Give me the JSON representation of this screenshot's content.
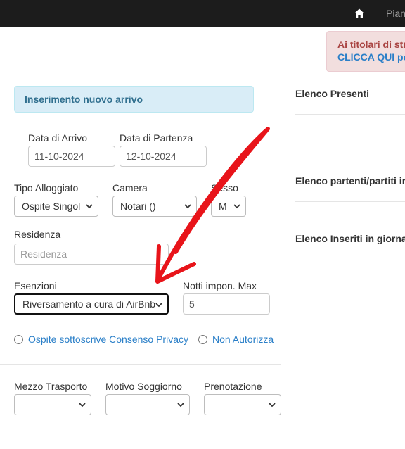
{
  "topbar": {
    "nav_label": "Pian"
  },
  "alert_danger": {
    "line1": "Ai titolari di str",
    "line2": "CLICCA QUI pe"
  },
  "form": {
    "heading": "Inserimento nuovo arrivo",
    "arrival": {
      "label": "Data di Arrivo",
      "value": "11-10-2024"
    },
    "departure": {
      "label": "Data di Partenza",
      "value": "12-10-2024"
    },
    "tipo_alloggiato": {
      "label": "Tipo Alloggiato",
      "value": "Ospite Singol"
    },
    "camera": {
      "label": "Camera",
      "value": "Notari ()"
    },
    "sesso": {
      "label": "Sesso",
      "value": "M"
    },
    "residenza": {
      "label": "Residenza",
      "placeholder": "Residenza"
    },
    "esenzioni": {
      "label": "Esenzioni",
      "value": "Riversamento a cura di AirBnb"
    },
    "notti": {
      "label": "Notti impon. Max",
      "value": "5"
    },
    "privacy_consent": {
      "label": "Ospite sottoscrive Consenso Privacy"
    },
    "privacy_deny": {
      "label": "Non Autorizza"
    },
    "mezzo_trasporto": {
      "label": "Mezzo Trasporto",
      "value": ""
    },
    "motivo_soggiorno": {
      "label": "Motivo Soggiorno",
      "value": ""
    },
    "prenotazione": {
      "label": "Prenotazione",
      "value": ""
    }
  },
  "sidebar": {
    "presenti": "Elenco Presenti",
    "partenti": "Elenco partenti/partiti in",
    "inseriti": "Elenco Inseriti in giorna"
  },
  "annotation": {
    "color": "#e8141a"
  }
}
